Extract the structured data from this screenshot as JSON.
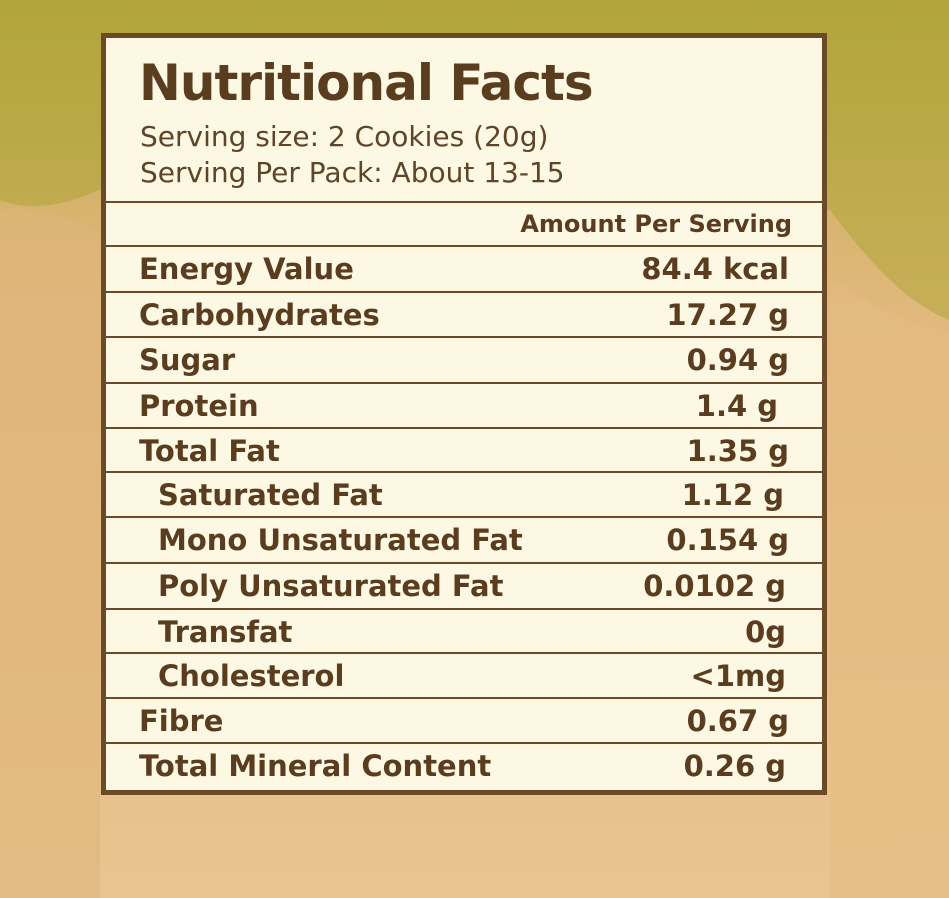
{
  "label": {
    "title": "Nutritional Facts",
    "serving_size": "Serving size:  2 Cookies (20g)",
    "servings_per_pack": "Serving Per Pack: About 13-15",
    "amount_header": "Amount Per Serving",
    "rows": [
      {
        "name": "Energy Value",
        "value": "84.4 kcal"
      },
      {
        "name": "Carbohydrates",
        "value": "17.27 g"
      },
      {
        "name": "Sugar",
        "value": "0.94 g"
      },
      {
        "name": "Protein",
        "value": "1.4 g"
      },
      {
        "name": "Total Fat",
        "value": "1.35 g"
      },
      {
        "name": "Saturated Fat",
        "value": "1.12 g"
      },
      {
        "name": "Mono Unsaturated Fat",
        "value": "0.154 g"
      },
      {
        "name": "Poly Unsaturated Fat",
        "value": "0.0102 g"
      },
      {
        "name": "Transfat",
        "value": "0g"
      },
      {
        "name": "Cholesterol",
        "value": "<1mg"
      },
      {
        "name": "Fibre",
        "value": "0.67 g"
      },
      {
        "name": "Total Mineral Content",
        "value": "0.26 g"
      }
    ]
  },
  "colors": {
    "text": "#5a3c1f",
    "border": "#6b4a28",
    "card_background": "#fdf8e4",
    "backdrop_top": "#b8a942",
    "backdrop_bottom": "#e9c48f"
  }
}
